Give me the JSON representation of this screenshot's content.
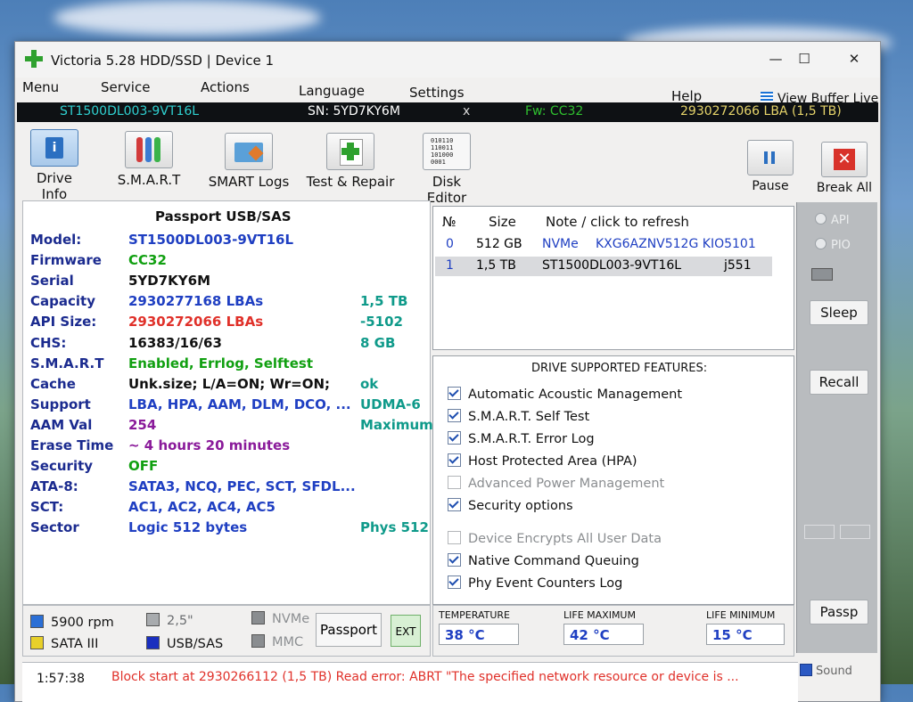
{
  "window": {
    "title": "Victoria 5.28 HDD/SSD | Device 1",
    "controls": {
      "minimize": "—",
      "maximize": "☐",
      "close": "✕"
    }
  },
  "menu": {
    "items": [
      "Menu",
      "Service",
      "Actions",
      "Language",
      "Settings"
    ],
    "help": "Help",
    "view_buffer": "View Buffer Live"
  },
  "device_bar": {
    "model": "ST1500DL003-9VT16L",
    "serial": "SN: 5YD7KY6M",
    "close": "x",
    "firmware": "Fw: CC32",
    "lba": "2930272066 LBA (1,5 TB)"
  },
  "toolbar": {
    "buttons": [
      {
        "label": "Drive Info",
        "icon": "drive-info-icon"
      },
      {
        "label": "S.M.A.R.T",
        "icon": "smart-icon"
      },
      {
        "label": "SMART Logs",
        "icon": "smart-logs-icon"
      },
      {
        "label": "Test & Repair",
        "icon": "test-repair-icon"
      },
      {
        "label": "Disk Editor",
        "icon": "disk-editor-icon"
      }
    ],
    "pause": "Pause",
    "break_all": "Break All"
  },
  "drive_info": {
    "header": "Passport USB/SAS",
    "rows": [
      {
        "key": "Model:",
        "value": "ST1500DL003-9VT16L",
        "extra": "",
        "color": "#1f3fc2"
      },
      {
        "key": "Firmware",
        "value": "CC32",
        "extra": "",
        "color": "#11a011"
      },
      {
        "key": "Serial",
        "value": "5YD7KY6M",
        "extra": "",
        "color": "#111111"
      },
      {
        "key": "Capacity",
        "value": "2930277168 LBAs",
        "extra": "1,5 TB",
        "color": "#1f3fc2"
      },
      {
        "key": "API Size:",
        "value": "2930272066 LBAs",
        "extra": "-5102",
        "color": "#e0312a"
      },
      {
        "key": "CHS:",
        "value": "16383/16/63",
        "extra": "8 GB",
        "color": "#111111"
      },
      {
        "key": "S.M.A.R.T",
        "value": "Enabled, Errlog, Selftest",
        "extra": "",
        "color": "#11a011"
      },
      {
        "key": "Cache",
        "value": "Unk.size; L/A=ON; Wr=ON;",
        "extra": "ok",
        "color": "#111111"
      },
      {
        "key": "Support",
        "value": "LBA, HPA, AAM, DLM, DCO, ...",
        "extra": "UDMA-6",
        "color": "#1f3fc2"
      },
      {
        "key": "AAM Val",
        "value": "254",
        "extra": "Maximum",
        "color": "#8a1a9a"
      },
      {
        "key": "Erase Time",
        "value": "~ 4 hours 20 minutes",
        "extra": "",
        "color": "#8a1a9a"
      },
      {
        "key": "Security",
        "value": "OFF",
        "extra": "",
        "color": "#11a011"
      },
      {
        "key": "ATA-8:",
        "value": "SATA3, NCQ, PEC, SCT, SFDL...",
        "extra": "",
        "color": "#1f3fc2"
      },
      {
        "key": "SCT:",
        "value": "AC1, AC2, AC4, AC5",
        "extra": "",
        "color": "#1f3fc2"
      },
      {
        "key": "Sector",
        "value": "Logic 512 bytes",
        "extra": "Phys 512",
        "color": "#1f3fc2"
      }
    ],
    "extra_color": "#0f9a8a"
  },
  "device_list": {
    "headers": [
      "№",
      "Size",
      "Note / click to refresh"
    ],
    "rows": [
      {
        "num": "0",
        "size": "512 GB",
        "type": "NVMe",
        "name": "KXG6AZNV512G KIO5101",
        "rev": ""
      },
      {
        "num": "1",
        "size": "1,5 TB",
        "type": "ST1500DL003-9VT16L",
        "name": "",
        "rev": "j551"
      }
    ]
  },
  "features": {
    "title": "DRIVE SUPPORTED FEATURES:",
    "items": [
      {
        "label": "Automatic Acoustic Management",
        "checked": true,
        "enabled": true
      },
      {
        "label": "S.M.A.R.T. Self Test",
        "checked": true,
        "enabled": true
      },
      {
        "label": "S.M.A.R.T. Error Log",
        "checked": true,
        "enabled": true
      },
      {
        "label": "Host Protected Area (HPA)",
        "checked": true,
        "enabled": true
      },
      {
        "label": "Advanced Power Management",
        "checked": false,
        "enabled": false
      },
      {
        "label": "Security options",
        "checked": true,
        "enabled": true
      },
      {
        "label": "Device Encrypts All User Data",
        "checked": false,
        "enabled": false
      },
      {
        "label": "Native Command Queuing",
        "checked": true,
        "enabled": true
      },
      {
        "label": "Phy Event Counters Log",
        "checked": true,
        "enabled": true
      }
    ]
  },
  "right_panel": {
    "api": "API",
    "pio": "PIO",
    "sleep": "Sleep",
    "recall": "Recall",
    "passp": "Passp",
    "sound": "Sound"
  },
  "status": {
    "rpm": "5900 rpm",
    "form": "2,5\"",
    "nvme": "NVMe",
    "sata": "SATA III",
    "usb": "USB/SAS",
    "mmc": "MMC",
    "passport": "Passport",
    "ext": "EXT"
  },
  "temps": {
    "temperature_label": "TEMPERATURE",
    "temperature": "38 °C",
    "life_max_label": "LIFE MAXIMUM",
    "life_max": "42 °C",
    "life_min_label": "LIFE MINIMUM",
    "life_min": "15 °C"
  },
  "log": {
    "time": "1:57:38",
    "message": "Block start at 2930266112 (1,5 TB) Read error: ABRT \"The specified network resource or device is ..."
  }
}
